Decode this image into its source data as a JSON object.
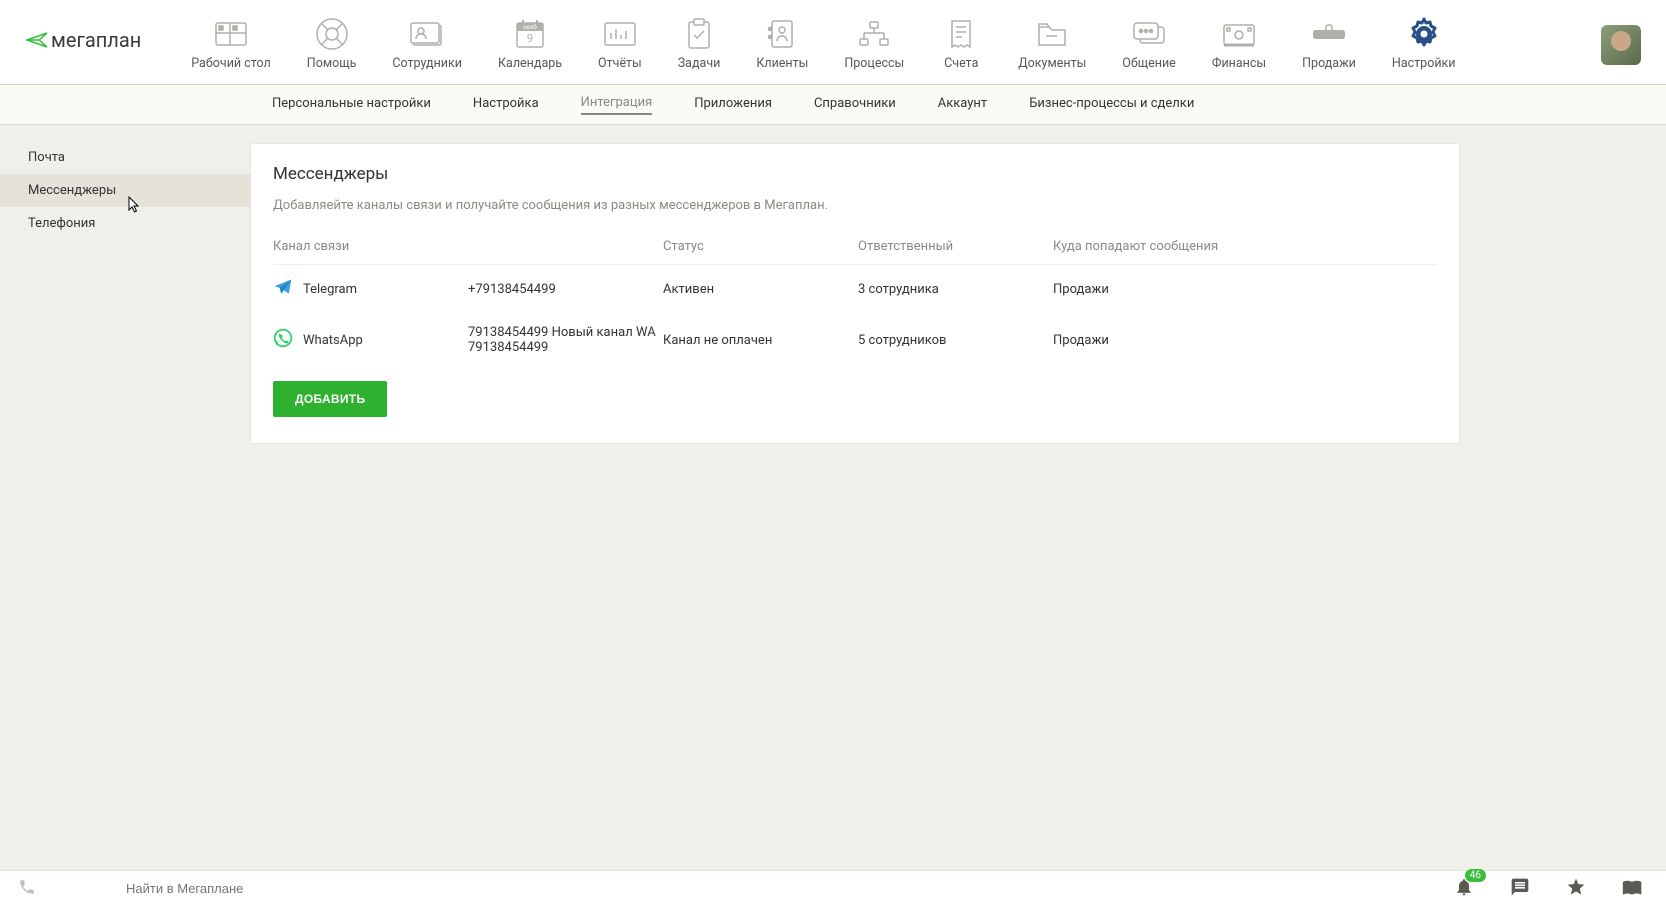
{
  "logo": {
    "text": "мегаплан"
  },
  "topnav": [
    {
      "id": "desktop",
      "label": "Рабочий стол"
    },
    {
      "id": "help",
      "label": "Помощь"
    },
    {
      "id": "employees",
      "label": "Сотрудники"
    },
    {
      "id": "calendar",
      "label": "Календарь",
      "badge_text": "нояб",
      "day": "9"
    },
    {
      "id": "reports",
      "label": "Отчёты"
    },
    {
      "id": "tasks",
      "label": "Задачи"
    },
    {
      "id": "clients",
      "label": "Клиенты"
    },
    {
      "id": "processes",
      "label": "Процессы"
    },
    {
      "id": "invoices",
      "label": "Счета"
    },
    {
      "id": "documents",
      "label": "Документы"
    },
    {
      "id": "communication",
      "label": "Общение"
    },
    {
      "id": "finance",
      "label": "Финансы"
    },
    {
      "id": "sales",
      "label": "Продажи"
    },
    {
      "id": "settings",
      "label": "Настройки",
      "active": true
    }
  ],
  "subnav": [
    {
      "label": "Персональные настройки"
    },
    {
      "label": "Настройка"
    },
    {
      "label": "Интеграция",
      "active": true
    },
    {
      "label": "Приложения"
    },
    {
      "label": "Справочники"
    },
    {
      "label": "Аккаунт"
    },
    {
      "label": "Бизнес-процессы и сделки"
    }
  ],
  "sidebar": [
    {
      "label": "Почта"
    },
    {
      "label": "Мессенджеры",
      "active": true
    },
    {
      "label": "Телефония"
    }
  ],
  "panel": {
    "title": "Мессенджеры",
    "description": "Добавляейте каналы связи и получайте сообщения из разных мессенджеров в Мегаплан.",
    "columns": {
      "channel": "Канал связи",
      "status": "Статус",
      "responsible": "Ответственный",
      "destination": "Куда попадают сообщения"
    },
    "rows": [
      {
        "icon": "telegram",
        "name": "Telegram",
        "number": "+79138454499",
        "status": "Активен",
        "status_class": "active",
        "responsible": "3 сотрудника",
        "destination": "Продажи"
      },
      {
        "icon": "whatsapp",
        "name": "WhatsApp",
        "number": "79138454499 Новый канал WA 79138454499",
        "status": "Канал не оплачен",
        "status_class": "unpaid",
        "responsible": "5 сотрудников",
        "destination": "Продажи"
      }
    ],
    "add_button": "ДОБАВИТЬ"
  },
  "bottombar": {
    "search_placeholder": "Найти в Мегаплане",
    "notification_count": "46"
  }
}
